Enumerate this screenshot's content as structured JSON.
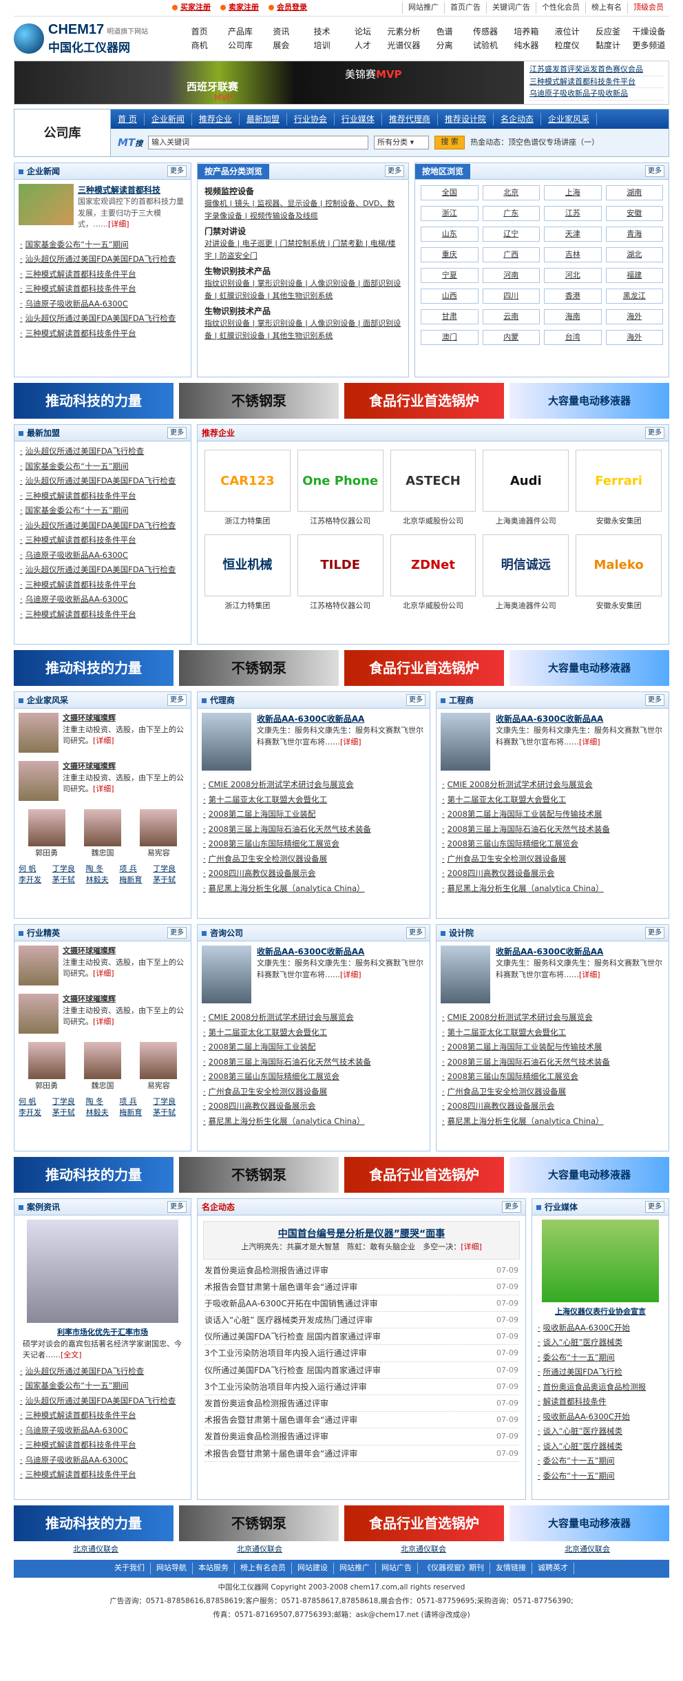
{
  "top": {
    "links": [
      "买家注册",
      "卖家注册",
      "会员登录"
    ],
    "right": [
      "网站推广",
      "首页广告",
      "关键词广告",
      "个性化会员",
      "榜上有名",
      "顶级会员"
    ]
  },
  "logo": {
    "en": "CHEM17",
    "slogan": "明道旗下网站",
    "cn": "中国化工仪器网"
  },
  "nav": [
    "首页",
    "产品库",
    "资讯",
    "技术",
    "论坛",
    "元素分析",
    "色谱",
    "传感器",
    "培养箱",
    "液位计",
    "反应釜",
    "干燥设备",
    "商机",
    "公司库",
    "展会",
    "培训",
    "人才",
    "光谱仪器",
    "分离",
    "试验机",
    "纯水器",
    "粒度仪",
    "黏度计",
    "更多频道"
  ],
  "banner": {
    "t1": "西班牙联赛",
    "t1s": "MVP",
    "t2a": "美锦赛",
    "t2b": "MVP",
    "links": [
      "江苏盛发首评奖运发首色赛仪会品",
      "三种模式解读首都科技条件平台",
      "乌迪原子吸收新品子吸收新品"
    ]
  },
  "lib": {
    "title": "公司库",
    "nav": [
      "首 页",
      "企业新闻",
      "推荐企业",
      "最新加盟",
      "行业协会",
      "行业媒体",
      "推荐代理商",
      "推荐设计院",
      "名企动态",
      "企业家风采"
    ],
    "mt": "MT",
    "mt_s": "搜",
    "input": "输入关键词",
    "select": "所有分类",
    "btn": "搜 索",
    "hot": "热金动态：顶空色谱仪专场讲座（一）"
  },
  "enews": {
    "title": "企业新闻",
    "more": "更多",
    "feat_title": "三种模式解读首都科技",
    "feat_desc": "国家宏观调控下的首都科技力量发展，主要归功于三大模式，……",
    "detail": "[详细]",
    "items": [
      "国家基金委公布“十一五”期间",
      "汕头超仪所通过美国FDA美国FDA飞行检查",
      "三种模式解读首都科技条件平台",
      "三种模式解读首都科技条件平台",
      "乌迪原子吸收新品AA-6300C",
      "汕头超仪所通过美国FDA美国FDA飞行检查",
      "三种模式解读首都科技条件平台"
    ]
  },
  "cats": {
    "title": "按产品分类浏览",
    "more": "更多",
    "groups": [
      {
        "t": "视频监控设备",
        "items": "摄像机 | 镜头 | 监视器、显示设备 | 控制设备、DVD、数字录像设备 | 视频传输设备及线缆"
      },
      {
        "t": "门禁对讲设",
        "items": "对讲设备 | 电子巡更 | 门禁控制系统 | 门禁考勤 | 电梯/楼宇 | 防盗安全门"
      },
      {
        "t": "生物识别技术产品",
        "items": "指纹识别设备 | 掌形识别设备 | 人像识别设备 | 面部识别设备 | 虹膜识别设备 | 其他生物识别系统"
      },
      {
        "t": "生物识别技术产品",
        "items": "指纹识别设备 | 掌形识别设备 | 人像识别设备 | 面部识别设备 | 虹膜识别设备 | 其他生物识别系统"
      }
    ]
  },
  "regions": {
    "title": "按地区浏览",
    "more": "更多",
    "items": [
      "全国",
      "北京",
      "上海",
      "湖南",
      "浙江",
      "广东",
      "江苏",
      "安徽",
      "山东",
      "辽宁",
      "天津",
      "青海",
      "重庆",
      "广西",
      "吉林",
      "湖北",
      "宁夏",
      "河南",
      "河北",
      "福建",
      "山西",
      "四川",
      "香港",
      "黑龙江",
      "甘肃",
      "云南",
      "海南",
      "海外",
      "澳门",
      "内蒙",
      "台湾",
      "海外"
    ]
  },
  "ads": [
    "推动科技的力量",
    "不锈钢泵",
    "食品行业首选锅炉",
    "大容量电动移液器"
  ],
  "newjoin": {
    "title": "最新加盟",
    "more": "更多",
    "items": [
      "汕头超仪所通过美国FDA飞行检查",
      "国家基金委公布“十一五”期间",
      "汕头超仪所通过美国FDA美国FDA飞行检查",
      "三种模式解读首都科技条件平台",
      "国家基金委公布“十一五”期间",
      "汕头超仪所通过美国FDA美国FDA飞行检查",
      "三种模式解读首都科技条件平台",
      "乌迪原子吸收新品AA-6300C",
      "汕头超仪所通过美国FDA美国FDA飞行检查",
      "三种模式解读首都科技条件平台",
      "乌迪原子吸收新品AA-6300C",
      "三种模式解读首都科技条件平台"
    ]
  },
  "recommend": {
    "title": "推荐企业",
    "more": "更多",
    "items": [
      {
        "logo": "CAR123",
        "name": "浙江力特集团"
      },
      {
        "logo": "One Phone",
        "name": "江苏格特仪器公司"
      },
      {
        "logo": "ASTECH",
        "name": "北京华威股份公司"
      },
      {
        "logo": "Audi",
        "name": "上海奥迪器件公司"
      },
      {
        "logo": "Ferrari",
        "name": "安徽永安集团"
      },
      {
        "logo": "恒业机械",
        "name": "浙江力特集团"
      },
      {
        "logo": "TILDE",
        "name": "江苏格特仪器公司"
      },
      {
        "logo": "ZDNet",
        "name": "北京华威股份公司"
      },
      {
        "logo": "明信诚远",
        "name": "上海奥迪器件公司"
      },
      {
        "logo": "Maleko",
        "name": "安徽永安集团"
      }
    ]
  },
  "entrepreneur": {
    "title": "企业家风采",
    "more": "更多",
    "p_title": "文摄环球璀璨辉",
    "p_desc": "注重主动投资、选股，由下至上的公司研究。",
    "detail": "[详细]",
    "faces": [
      "郭田勇",
      "魏忠国",
      "易宪容"
    ],
    "names": [
      "何 帆",
      "丁学良",
      "陶 冬",
      "项 兵",
      "丁学良",
      "李开发",
      "茅于轼",
      "林毅夫",
      "梅新育",
      "茅于轼"
    ]
  },
  "elite": {
    "title": "行业精英",
    "more": "更多"
  },
  "agent": {
    "titles": [
      "代理商",
      "工程商",
      "咨询公司",
      "设计院"
    ],
    "more": "更多",
    "name": "收新品AA-6300C收新品AA",
    "desc": "文康先生：服务科文康先生：服务科文赛默飞世尔科赛默飞世尔宣布将……",
    "detail": "[详细]",
    "items": [
      "CMIE 2008分析测试学术研讨会与展览会",
      "第十二届亚太化工联盟大会暨化工",
      "2008第二届上海国际工业装配",
      "2008第三届上海国际石油石化天然气技术装备",
      "2008第三届山东国际精细化工展览会",
      "广州食品卫生安全检测仪器设备展",
      "2008四川高教仪器设备展示会",
      "慕尼黑上海分析生化展（analytica China）"
    ],
    "items2": [
      "CMIE 2008分析测试学术研讨会与展览会",
      "第十二届亚太化工联盟大会暨化工",
      "2008第二届上海国际工业装配与传输技术展",
      "2008第三届上海国际石油石化天然气技术装备",
      "2008第三届山东国际精细化工展览会",
      "广州食品卫生安全检测仪器设备展",
      "2008四川高教仪器设备展示会",
      "慕尼黑上海分析生化展（analytica China）"
    ]
  },
  "cases": {
    "title": "案例资讯",
    "more": "更多",
    "img_title": "利率市场化优先于汇率市场",
    "desc": "硕学对谈会的嘉宾包括著名经济学家谢国忠、今天记者……",
    "all": "[全文]",
    "items": [
      "汕头超仪所通过美国FDA飞行检查",
      "国家基金委公布“十一五”期间",
      "汕头超仪所通过美国FDA美国FDA飞行检查",
      "三种模式解读首都科技条件平台",
      "乌迪原子吸收新品AA-6300C",
      "三种模式解读首都科技条件平台",
      "乌迪原子吸收新品AA-6300C",
      "三种模式解读首都科技条件平台"
    ]
  },
  "famous": {
    "title": "名企动态",
    "more": "更多",
    "ft": "中国首台编号是分析是仪器”腰哭“面事",
    "fs": "上汽明亮先：共赢才是大智慧　陈虹：敢有头脑企业　多空一决：",
    "detail": "[详细]",
    "items": [
      [
        "发首份奥运食品检测报告通过评审",
        "07-09"
      ],
      [
        "术报告会暨甘肃第十届色谱年会“通过评审",
        "07-09"
      ],
      [
        "于吸收新品AA-6300C开拓在中国销售通过评审",
        "07-09"
      ],
      [
        "谈话入“心脏” 医疗器械类开发成热门通过评审",
        "07-09"
      ],
      [
        "仪所通过美国FDA飞行检查 屈国内首家通过评审",
        "07-09"
      ],
      [
        "3个工业污染防治项目年内投入运行通过评审",
        "07-09"
      ],
      [
        "仪所通过美国FDA飞行检查 屈国内首家通过评审",
        "07-09"
      ],
      [
        "3个工业污染防治项目年内投入运行通过评审",
        "07-09"
      ],
      [
        "发首份奥运食品检测报告通过评审",
        "07-09"
      ],
      [
        "术报告会暨甘肃第十届色谱年会“通过评审",
        "07-09"
      ],
      [
        "发首份奥运食品检测报告通过评审",
        "07-09"
      ],
      [
        "术报告会暨甘肃第十届色谱年会“通过评审",
        "07-09"
      ]
    ]
  },
  "media": {
    "title": "行业媒体",
    "more": "更多",
    "cap": "上海仪器仪表行业协会宣言",
    "items": [
      "吸收新品AA-6300C开始",
      "谈入“心脏”医疗器械类",
      "委公布“十一五”期间",
      "所通过美国FDA飞行检",
      "首份奥运食品奥运食品检测报",
      "解读首都科技条件",
      "吸收新品AA-6300C开始",
      "谈入“心脏”医疗器械类",
      "谈入“心脏”医疗器械类",
      "委公布“十一五”期间",
      "委公布“十一五”期间"
    ]
  },
  "sponsor": [
    "北京通仪联会",
    "北京通仪联会",
    "北京通仪联会",
    "北京通仪联会"
  ],
  "footnav": [
    "关于我们",
    "网站导航",
    "本站服务",
    "榜上有名会员",
    "网站建设",
    "网站推广",
    "网站广告",
    "《仪器视窗》期刊",
    "友情链接",
    "诚聘英才"
  ],
  "footinfo": [
    "中国化工仪器网 Copyright 2003-2008 chem17.com,all rights reserved",
    "广告咨询：0571-87858616,87858619;客户服务：0571-87858617,87858618,展会合作：0571-87759695;采购咨询：0571-87756390;",
    "传真：0571-87169507,87756393;邮箱：ask@chem17.net (请将@改成@)"
  ]
}
